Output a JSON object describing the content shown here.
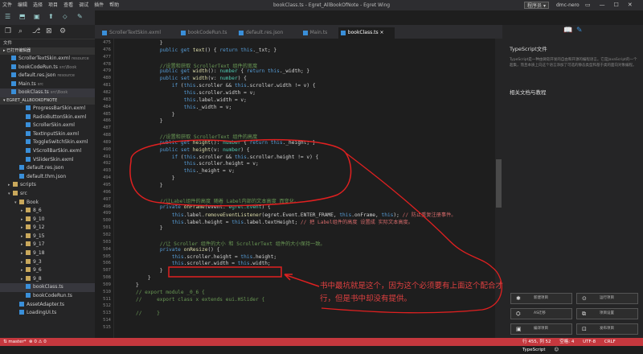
{
  "window": {
    "title": "bookClass.ts - Egret_AllBookOfNote - Egret Wing",
    "menus": [
      "文件",
      "编辑",
      "选择",
      "项目",
      "查看",
      "调试",
      "插件",
      "帮助"
    ],
    "program_label": "程序员",
    "program_arrow": "▾",
    "user": "dmc-nero",
    "controls": [
      "▭",
      "—",
      "☐",
      "✕"
    ]
  },
  "toolbar": {
    "icons": [
      "☰",
      "⬒",
      "▣",
      "⬆",
      "⬦",
      "✎"
    ]
  },
  "sidebar": {
    "icons": [
      "❐",
      "⌕",
      "⎇",
      "⊠",
      "⚙"
    ],
    "title": "文件",
    "open_section": "▸ 已打开编辑器",
    "open_files": [
      {
        "name": "ScrollerTextSkin.exml",
        "dir": "resource"
      },
      {
        "name": "bookCodeRun.ts",
        "dir": "src\\Book"
      },
      {
        "name": "default.res.json",
        "dir": "resource"
      },
      {
        "name": "Main.ts",
        "dir": "src"
      },
      {
        "name": "bookClass.ts",
        "dir": "src\\Book"
      }
    ],
    "project_section": "▾ EGRET_ALLBOOKOFNOTE",
    "tree": [
      {
        "name": "ProgressBarSkin.exml",
        "indent": 3,
        "type": "file"
      },
      {
        "name": "RadioButtonSkin.exml",
        "indent": 3,
        "type": "file"
      },
      {
        "name": "ScrollerSkin.exml",
        "indent": 3,
        "type": "file"
      },
      {
        "name": "TextInputSkin.exml",
        "indent": 3,
        "type": "file"
      },
      {
        "name": "ToggleSwitchSkin.exml",
        "indent": 3,
        "type": "file"
      },
      {
        "name": "VScrollBarSkin.exml",
        "indent": 3,
        "type": "file"
      },
      {
        "name": "VSliderSkin.exml",
        "indent": 3,
        "type": "file"
      },
      {
        "name": "default.res.json",
        "indent": 2,
        "type": "file"
      },
      {
        "name": "default.thm.json",
        "indent": 2,
        "type": "file"
      },
      {
        "name": "scripts",
        "indent": 1,
        "type": "folder",
        "arrow": "▸"
      },
      {
        "name": "src",
        "indent": 1,
        "type": "folder",
        "arrow": "▾"
      },
      {
        "name": "Book",
        "indent": 2,
        "type": "folder",
        "arrow": "▾"
      },
      {
        "name": "8_6",
        "indent": 3,
        "type": "folder",
        "arrow": "▸"
      },
      {
        "name": "9_10",
        "indent": 3,
        "type": "folder",
        "arrow": "▸"
      },
      {
        "name": "9_12",
        "indent": 3,
        "type": "folder",
        "arrow": "▸"
      },
      {
        "name": "9_15",
        "indent": 3,
        "type": "folder",
        "arrow": "▸"
      },
      {
        "name": "9_17",
        "indent": 3,
        "type": "folder",
        "arrow": "▸"
      },
      {
        "name": "9_18",
        "indent": 3,
        "type": "folder",
        "arrow": "▸"
      },
      {
        "name": "9_3",
        "indent": 3,
        "type": "folder",
        "arrow": "▸"
      },
      {
        "name": "9_6",
        "indent": 3,
        "type": "folder",
        "arrow": "▸"
      },
      {
        "name": "9_8",
        "indent": 3,
        "type": "folder",
        "arrow": "▸"
      },
      {
        "name": "bookClass.ts",
        "indent": 3,
        "type": "file",
        "active": true
      },
      {
        "name": "bookCodeRun.ts",
        "indent": 3,
        "type": "file"
      },
      {
        "name": "AssetAdapter.ts",
        "indent": 2,
        "type": "file"
      },
      {
        "name": "LoadingUI.ts",
        "indent": 2,
        "type": "file"
      }
    ]
  },
  "tabs": [
    {
      "label": "ScrollerTextSkin.exml",
      "active": false
    },
    {
      "label": "bookCodeRun.ts",
      "active": false
    },
    {
      "label": "default.res.json",
      "active": false
    },
    {
      "label": "Main.ts",
      "active": false
    },
    {
      "label": "bookClass.ts ×",
      "active": true
    }
  ],
  "code": {
    "line_numbers": [
      "475",
      "476",
      "477",
      "478",
      "479",
      "480",
      "481",
      "482",
      "483",
      "484",
      "485",
      "486",
      "487",
      "488",
      "489",
      "490",
      "491",
      "492",
      "493",
      "494",
      "495",
      "496",
      "497",
      "498",
      "499",
      "500",
      "501",
      "502",
      "503",
      "504",
      "505",
      "506",
      "507",
      "508",
      "509",
      "510",
      "511",
      "512",
      "513",
      "514",
      "515"
    ],
    "lines": [
      [
        {
          "t": "        }",
          "c": ""
        }
      ],
      [
        {
          "t": "        ",
          "c": ""
        },
        {
          "t": "public get ",
          "c": "kw"
        },
        {
          "t": "text",
          "c": "fn"
        },
        {
          "t": "() { ",
          "c": ""
        },
        {
          "t": "return this",
          "c": "kw"
        },
        {
          "t": "._txt; }",
          "c": ""
        }
      ],
      [
        {
          "t": "",
          "c": ""
        }
      ],
      [
        {
          "t": "        //设置和获取 ScrollerText 组件的宽度",
          "c": "cm"
        }
      ],
      [
        {
          "t": "        ",
          "c": ""
        },
        {
          "t": "public get ",
          "c": "kw"
        },
        {
          "t": "width",
          "c": "fn"
        },
        {
          "t": "(): ",
          "c": ""
        },
        {
          "t": "number",
          "c": "ty"
        },
        {
          "t": " { ",
          "c": ""
        },
        {
          "t": "return this",
          "c": "kw"
        },
        {
          "t": "._width; }",
          "c": ""
        }
      ],
      [
        {
          "t": "        ",
          "c": ""
        },
        {
          "t": "public set ",
          "c": "kw"
        },
        {
          "t": "width",
          "c": "fn"
        },
        {
          "t": "(v: ",
          "c": ""
        },
        {
          "t": "number",
          "c": "ty"
        },
        {
          "t": ") {",
          "c": ""
        }
      ],
      [
        {
          "t": "            ",
          "c": ""
        },
        {
          "t": "if",
          "c": "kw"
        },
        {
          "t": " (",
          "c": ""
        },
        {
          "t": "this",
          "c": "kw"
        },
        {
          "t": ".scroller && ",
          "c": ""
        },
        {
          "t": "this",
          "c": "kw"
        },
        {
          "t": ".scroller.width != v) {",
          "c": ""
        }
      ],
      [
        {
          "t": "                ",
          "c": ""
        },
        {
          "t": "this",
          "c": "kw"
        },
        {
          "t": ".scroller.width = v;",
          "c": ""
        }
      ],
      [
        {
          "t": "                ",
          "c": ""
        },
        {
          "t": "this",
          "c": "kw"
        },
        {
          "t": ".label.width = v;",
          "c": ""
        }
      ],
      [
        {
          "t": "                ",
          "c": ""
        },
        {
          "t": "this",
          "c": "kw"
        },
        {
          "t": "._width = v;",
          "c": ""
        }
      ],
      [
        {
          "t": "            }",
          "c": ""
        }
      ],
      [
        {
          "t": "        }",
          "c": ""
        }
      ],
      [
        {
          "t": "",
          "c": ""
        }
      ],
      [
        {
          "t": "        //设置和获取 ScrollerText 组件的高度",
          "c": "cm"
        }
      ],
      [
        {
          "t": "        ",
          "c": ""
        },
        {
          "t": "public get ",
          "c": "kw"
        },
        {
          "t": "height",
          "c": "fn"
        },
        {
          "t": "(): ",
          "c": ""
        },
        {
          "t": "number",
          "c": "ty"
        },
        {
          "t": " { ",
          "c": ""
        },
        {
          "t": "return this",
          "c": "kw"
        },
        {
          "t": "._height; }",
          "c": ""
        }
      ],
      [
        {
          "t": "        ",
          "c": ""
        },
        {
          "t": "public set ",
          "c": "kw"
        },
        {
          "t": "height",
          "c": "fn"
        },
        {
          "t": "(v: ",
          "c": ""
        },
        {
          "t": "number",
          "c": "ty"
        },
        {
          "t": ") {",
          "c": ""
        }
      ],
      [
        {
          "t": "            ",
          "c": ""
        },
        {
          "t": "if",
          "c": "kw"
        },
        {
          "t": " (",
          "c": ""
        },
        {
          "t": "this",
          "c": "kw"
        },
        {
          "t": ".scroller && ",
          "c": ""
        },
        {
          "t": "this",
          "c": "kw"
        },
        {
          "t": ".scroller.height != v) {",
          "c": ""
        }
      ],
      [
        {
          "t": "                ",
          "c": ""
        },
        {
          "t": "this",
          "c": "kw"
        },
        {
          "t": ".scroller.height = v;",
          "c": ""
        }
      ],
      [
        {
          "t": "                ",
          "c": ""
        },
        {
          "t": "this",
          "c": "kw"
        },
        {
          "t": "._height = v;",
          "c": ""
        }
      ],
      [
        {
          "t": "            }",
          "c": ""
        }
      ],
      [
        {
          "t": "        }",
          "c": ""
        }
      ],
      [
        {
          "t": "",
          "c": ""
        }
      ],
      [
        {
          "t": "        //让Label组件的高度 随着 Label内部的文本高度 而变化。",
          "c": "cm"
        }
      ],
      [
        {
          "t": "        ",
          "c": ""
        },
        {
          "t": "private ",
          "c": "kw"
        },
        {
          "t": "onFrame",
          "c": "fn"
        },
        {
          "t": "(event: ",
          "c": ""
        },
        {
          "t": "egret.Event",
          "c": "ty"
        },
        {
          "t": ") {",
          "c": ""
        }
      ],
      [
        {
          "t": "            ",
          "c": ""
        },
        {
          "t": "this",
          "c": "kw"
        },
        {
          "t": ".label.",
          "c": ""
        },
        {
          "t": "removeEventListener",
          "c": "fn"
        },
        {
          "t": "(egret.Event.ENTER_FRAME, ",
          "c": ""
        },
        {
          "t": "this",
          "c": "kw"
        },
        {
          "t": ".onFrame, ",
          "c": ""
        },
        {
          "t": "this",
          "c": "kw"
        },
        {
          "t": "); ",
          "c": ""
        },
        {
          "t": "// 防止重复注册事件。",
          "c": "cmr"
        }
      ],
      [
        {
          "t": "            ",
          "c": ""
        },
        {
          "t": "this",
          "c": "kw"
        },
        {
          "t": ".label.height = ",
          "c": ""
        },
        {
          "t": "this",
          "c": "kw"
        },
        {
          "t": ".label.textHeight; ",
          "c": ""
        },
        {
          "t": "// 把 Label组件的高度 设置成 实际文本高度。",
          "c": "cmr"
        }
      ],
      [
        {
          "t": "        }",
          "c": ""
        }
      ],
      [
        {
          "t": "",
          "c": ""
        }
      ],
      [
        {
          "t": "        //让 Scroller 组件的大小 和 ScrollerText 组件的大小保持一致。",
          "c": "cm"
        }
      ],
      [
        {
          "t": "        ",
          "c": ""
        },
        {
          "t": "private ",
          "c": "kw"
        },
        {
          "t": "onResize",
          "c": "fn"
        },
        {
          "t": "() {",
          "c": ""
        }
      ],
      [
        {
          "t": "            ",
          "c": ""
        },
        {
          "t": "this",
          "c": "kw"
        },
        {
          "t": ".scroller.height = ",
          "c": ""
        },
        {
          "t": "this",
          "c": "kw"
        },
        {
          "t": ".height;",
          "c": ""
        }
      ],
      [
        {
          "t": "            ",
          "c": ""
        },
        {
          "t": "this",
          "c": "kw"
        },
        {
          "t": ".scroller.width = ",
          "c": ""
        },
        {
          "t": "this",
          "c": "kw"
        },
        {
          "t": ".width;",
          "c": ""
        }
      ],
      [
        {
          "t": "        }",
          "c": ""
        }
      ],
      [
        {
          "t": "    }",
          "c": ""
        }
      ],
      [
        {
          "t": "}",
          "c": ""
        }
      ],
      [
        {
          "t": "// export module _0_6 {",
          "c": "cm"
        }
      ],
      [
        {
          "t": "//     export class x extends eui.HSlider {",
          "c": "cm"
        }
      ],
      [
        {
          "t": "",
          "c": ""
        }
      ],
      [
        {
          "t": "//     }",
          "c": "cm"
        }
      ],
      [
        {
          "t": "",
          "c": ""
        }
      ],
      [
        {
          "t": "",
          "c": ""
        }
      ]
    ]
  },
  "right_panel": {
    "icons": [
      "📖",
      "✎"
    ],
    "heading": "TypeScript文件",
    "description": "TypeScript是一种由微软开发的自由和开源的编程语言。它是JavaScript的一个超集，而且本质上向这个语言添加了可选的静态类型和基于类的面向对象编程。",
    "related_title": "相关文档与教程",
    "buttons": [
      {
        "icon": "✱",
        "label": "新建项目"
      },
      {
        "icon": "⊙",
        "label": "运行项目"
      },
      {
        "icon": "⛭",
        "label": "AS迁移"
      },
      {
        "icon": "⧉",
        "label": "项目设置"
      },
      {
        "icon": "▣",
        "label": "编译项目"
      },
      {
        "icon": "⊡",
        "label": "发布项目"
      }
    ]
  },
  "status": {
    "branch": "⇅ master*",
    "errors": "⊗ 0 ⚠ 0",
    "position": "行 455, 列 52",
    "spaces": "空格: 4",
    "encoding": "UTF-8",
    "eol": "CRLF",
    "language": "TypeScript",
    "smile": "☺"
  },
  "annotation": {
    "note": "书中最坑就是这个，因为这个必须要有上面这个配合才行，但是书中却没有提供。",
    "color": "#e03030"
  }
}
